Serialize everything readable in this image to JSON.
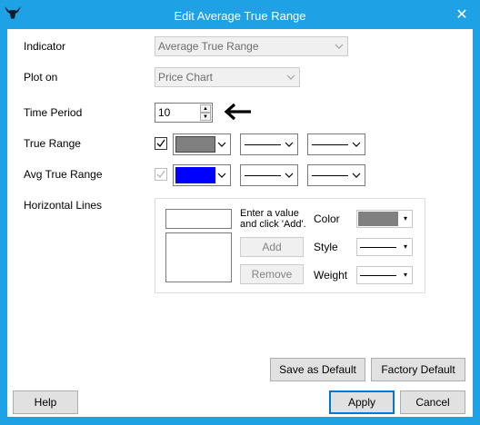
{
  "window": {
    "title": "Edit Average True Range",
    "close_glyph": "✕",
    "icon": "bull-logo-icon"
  },
  "form": {
    "indicator": {
      "label": "Indicator",
      "value": "Average True Range"
    },
    "plot_on": {
      "label": "Plot on",
      "value": "Price Chart"
    },
    "time_period": {
      "label": "Time Period",
      "value": "10"
    },
    "true_range": {
      "label": "True Range",
      "checked": true,
      "color": "#808080"
    },
    "avg_true_range": {
      "label": "Avg True Range",
      "checked": true,
      "checkbox_disabled": true,
      "color": "#0000ff"
    },
    "horizontal_lines": {
      "label": "Horizontal Lines",
      "hint": "Enter a value and click 'Add'.",
      "add_label": "Add",
      "remove_label": "Remove",
      "color_label": "Color",
      "style_label": "Style",
      "weight_label": "Weight",
      "color": "#808080"
    }
  },
  "buttons": {
    "save_default": "Save as Default",
    "factory_default": "Factory Default",
    "help": "Help",
    "apply": "Apply",
    "cancel": "Cancel"
  },
  "colors": {
    "titlebar": "#1ea1e5",
    "accent": "#0078d7"
  }
}
